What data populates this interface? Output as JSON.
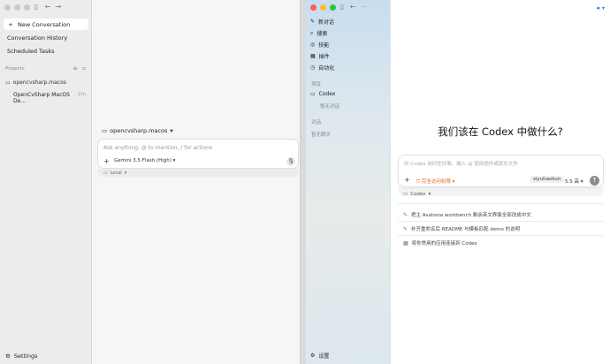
{
  "left_window": {
    "sidebar": {
      "nav": [
        {
          "label": "New Conversation",
          "icon": "plus-icon"
        },
        {
          "label": "Conversation History",
          "icon": "history-icon"
        },
        {
          "label": "Scheduled Tasks",
          "icon": "clock-icon"
        }
      ],
      "projects_label": "Projects",
      "project_name": "opencvsharp.macos",
      "thread": {
        "title": "OpenCvSharp MacOS De...",
        "time": "2m"
      },
      "settings_label": "Settings"
    },
    "main": {
      "project_selector": "opencvsharp.macos",
      "composer_placeholder": "Ask anything, @ to mention, / for actions",
      "model_label": "Gemini 3.5 Flash (High)",
      "mode_label": "Local"
    }
  },
  "right_window": {
    "sidebar": {
      "items": [
        {
          "label": "新对话",
          "icon": "compose-icon"
        },
        {
          "label": "搜索",
          "icon": "search-icon"
        },
        {
          "label": "技能",
          "icon": "skills-icon"
        },
        {
          "label": "插件",
          "icon": "plugin-icon"
        },
        {
          "label": "自动化",
          "icon": "clock-icon"
        }
      ],
      "projects_label": "项目",
      "project_name": "Codex",
      "project_empty": "暂无对话",
      "chats_label": "对话",
      "chats_empty": "暂无聊天",
      "settings_label": "设置"
    },
    "main": {
      "heading": "我们该在 Codex 中做什么?",
      "composer_placeholder": "向 Codex 询问任何事。输入 @ 使用插件或提及文件",
      "access_label": "完全访问权限",
      "user_label": "ziyuhaokun",
      "ratio_label": "5.5 高",
      "workspace_label": "Codex",
      "suggestions": [
        "把主 Avalonia workbench 剩余英文界面全部改成中文",
        "补齐重命名后 README 与模板匹配 demo 的说明",
        "将你常用的应用连接到 Codex"
      ]
    }
  },
  "colors": {
    "accent_blue": "#1a73e8",
    "access_orange": "#e0651c"
  }
}
